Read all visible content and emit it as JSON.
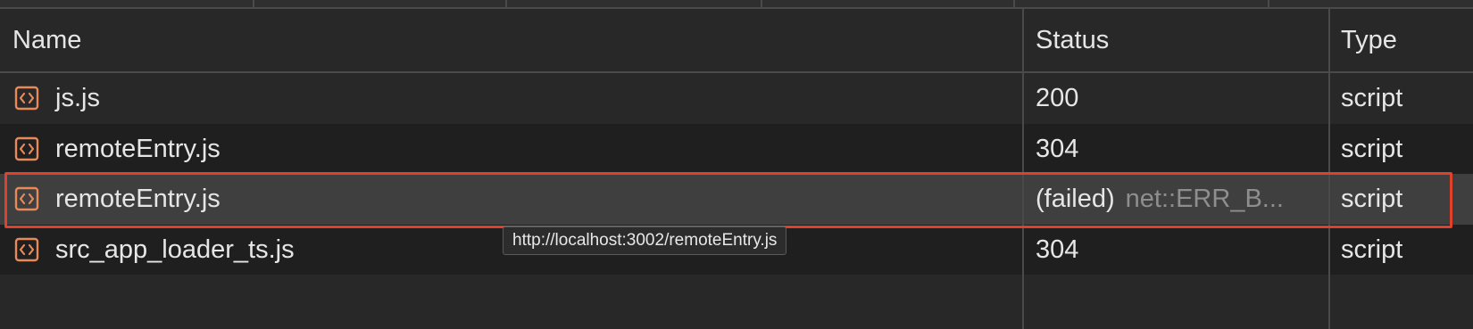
{
  "columns": {
    "name": "Name",
    "status": "Status",
    "type": "Type"
  },
  "rows": [
    {
      "icon": "script-file-icon",
      "name": "js.js",
      "status": "200",
      "status_detail": "",
      "type": "script"
    },
    {
      "icon": "script-file-icon",
      "name": "remoteEntry.js",
      "status": "304",
      "status_detail": "",
      "type": "script"
    },
    {
      "icon": "script-file-icon",
      "name": "remoteEntry.js",
      "status": "(failed)",
      "status_detail": "net::ERR_B...",
      "type": "script"
    },
    {
      "icon": "script-file-icon",
      "name": "src_app_loader_ts.js",
      "status": "304",
      "status_detail": "",
      "type": "script"
    }
  ],
  "tooltip": {
    "text": "http://localhost:3002/remoteEntry.js"
  },
  "colors": {
    "icon_orange": "#e8895a",
    "highlight_red": "#e0412b",
    "background": "#282828",
    "row_alt": "#1f1f1f",
    "row_selected": "#3f3f3f"
  }
}
